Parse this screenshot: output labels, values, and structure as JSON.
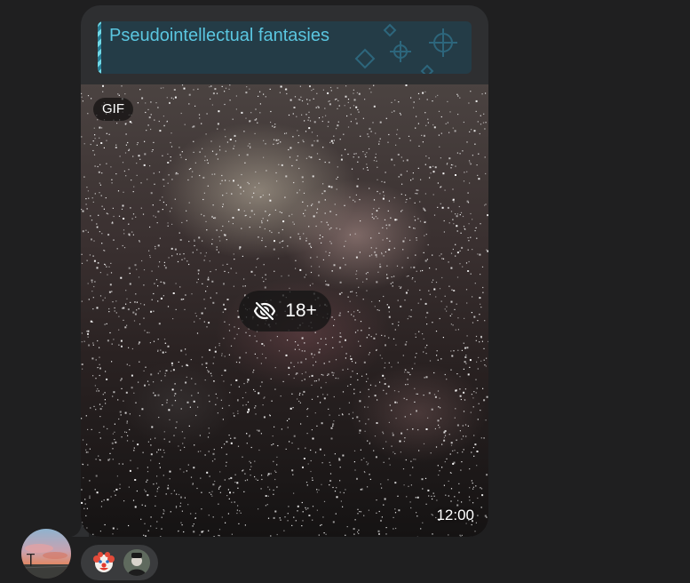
{
  "message": {
    "reply": {
      "title": "Pseudointellectual fantasies"
    },
    "media": {
      "badge": "GIF",
      "spoiler_label": "18+",
      "spoiler_icon": "eye-slash-icon",
      "time": "12:00"
    }
  },
  "reactions": [
    {
      "emoji_icon": "clown-face-icon"
    }
  ],
  "colors": {
    "background": "#1f1f20",
    "bubble": "#2e2f31",
    "reply_background": "#243c47",
    "reply_accent": "#5ac6e0"
  }
}
